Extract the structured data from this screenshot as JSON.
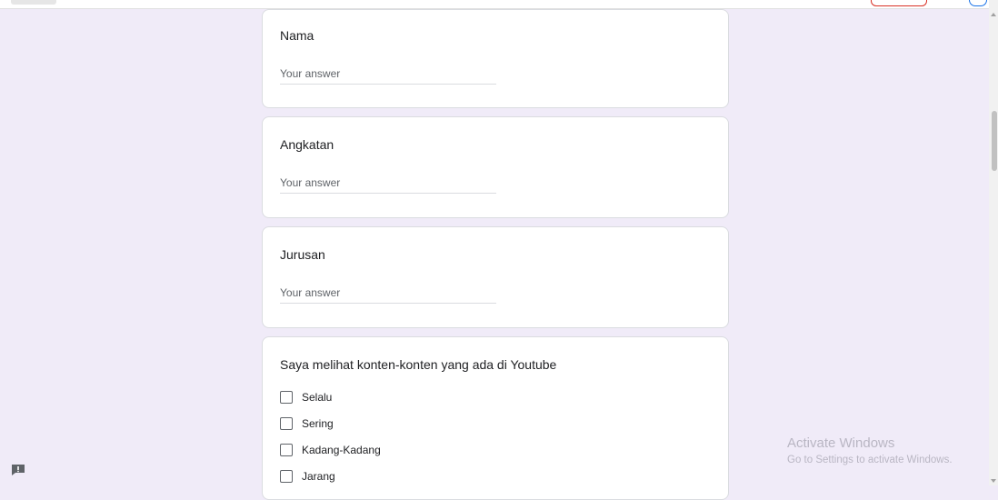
{
  "form": {
    "answer_placeholder": "Your answer",
    "questions": [
      {
        "title": "Nama"
      },
      {
        "title": "Angkatan"
      },
      {
        "title": "Jurusan"
      },
      {
        "title": "Saya melihat konten-konten yang ada di Youtube",
        "options": [
          "Selalu",
          "Sering",
          "Kadang-Kadang",
          "Jarang"
        ]
      }
    ]
  },
  "watermark": {
    "title": "Activate Windows",
    "subtitle": "Go to Settings to activate Windows."
  },
  "icons": {
    "feedback": "feedback-icon",
    "checkbox": "checkbox-icon"
  },
  "colors": {
    "page_background": "#f0ebf8",
    "card_background": "#ffffff",
    "card_border": "#dadce0",
    "text": "#202124",
    "placeholder": "#5f6368"
  }
}
